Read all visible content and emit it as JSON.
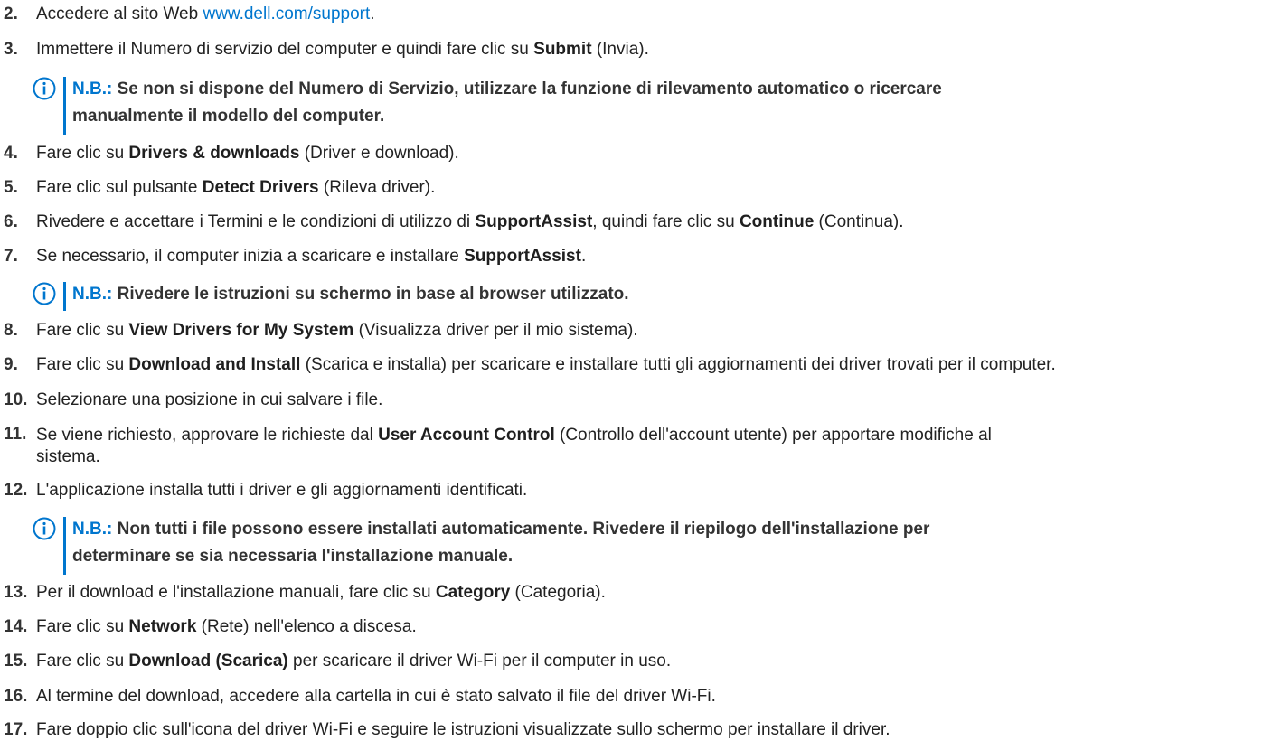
{
  "steps": [
    {
      "n": "2.",
      "pre": "Accedere al sito Web ",
      "link": "www.dell.com/support",
      "post": "."
    },
    {
      "n": "3.",
      "pre": "Immettere il Numero di servizio del computer e quindi fare clic su ",
      "b1": "Submit",
      "post": " (Invia)."
    },
    {
      "n": "4.",
      "pre": "Fare clic su ",
      "b1": "Drivers & downloads",
      "post": " (Driver e download)."
    },
    {
      "n": "5.",
      "pre": "Fare clic sul pulsante ",
      "b1": "Detect Drivers",
      "post": " (Rileva driver)."
    },
    {
      "n": "6.",
      "pre": "Rivedere e accettare i Termini e le condizioni di utilizzo di ",
      "b1": "SupportAssist",
      "mid": ", quindi fare clic su ",
      "b2": "Continue",
      "post": " (Continua)."
    },
    {
      "n": "7.",
      "pre": "Se necessario, il computer inizia a scaricare e installare ",
      "b1": "SupportAssist",
      "post": "."
    },
    {
      "n": "8.",
      "pre": "Fare clic su ",
      "b1": "View Drivers for My System",
      "post": " (Visualizza driver per il mio sistema)."
    },
    {
      "n": "9.",
      "pre": "Fare clic su ",
      "b1": "Download and Install",
      "post": " (Scarica e installa) per scaricare e installare tutti gli aggiornamenti dei driver trovati per il computer."
    },
    {
      "n": "10.",
      "pre": "Selezionare una posizione in cui salvare i file."
    },
    {
      "n": "11.",
      "pre": "Se viene richiesto, approvare le richieste dal ",
      "b1": "User Account Control",
      "post": " (Controllo dell'account utente) per apportare modifiche al sistema."
    },
    {
      "n": "12.",
      "pre": "L'applicazione installa tutti i driver e gli aggiornamenti identificati."
    },
    {
      "n": "13.",
      "pre": "Per il download e l'installazione manuali, fare clic su ",
      "b1": "Category",
      "post": " (Categoria)."
    },
    {
      "n": "14.",
      "pre": "Fare clic su ",
      "b1": "Network",
      "post": " (Rete) nell'elenco a discesa."
    },
    {
      "n": "15.",
      "pre": "Fare clic su ",
      "b1": "Download (Scarica)",
      "post": " per scaricare il driver Wi-Fi per il computer in uso."
    },
    {
      "n": "16.",
      "pre": "Al termine del download, accedere alla cartella in cui è stato salvato il file del driver Wi-Fi."
    },
    {
      "n": "17.",
      "pre": "Fare doppio clic sull'icona del driver Wi-Fi e seguire le istruzioni visualizzate sullo schermo per installare il driver."
    }
  ],
  "notes": [
    {
      "label": "N.B.:",
      "text": " Se non si dispone del Numero di Servizio, utilizzare la funzione di rilevamento automatico o ricercare manualmente il modello del computer."
    },
    {
      "label": "N.B.:",
      "text": " Rivedere le istruzioni su schermo in base al browser utilizzato."
    },
    {
      "label": "N.B.:",
      "text": " Non tutti i file possono essere installati automaticamente. Rivedere il riepilogo dell'installazione per determinare se sia necessaria l'installazione manuale."
    }
  ],
  "colors": {
    "accent": "#0076ce",
    "text": "#222222"
  },
  "icons": {
    "note": "info-circle-icon"
  }
}
